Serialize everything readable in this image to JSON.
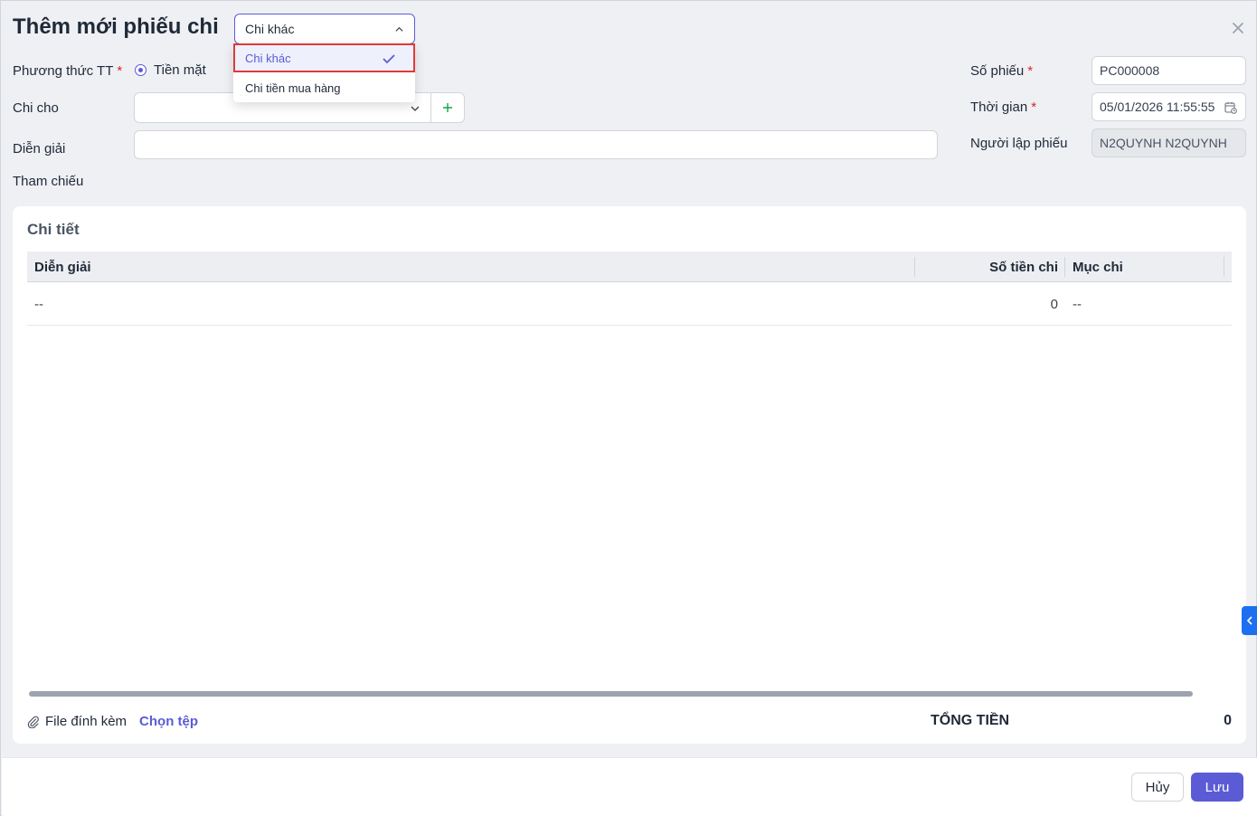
{
  "modal": {
    "title": "Thêm mới phiếu chi",
    "type_select_value": "Chi khác",
    "type_options": [
      "Chi khác",
      "Chi tiền mua hàng"
    ]
  },
  "form": {
    "payment_method_label": "Phương thức TT",
    "payment_method_value": "Tiền mặt",
    "pay_to_label": "Chi cho",
    "pay_to_value": "",
    "description_label": "Diễn giải",
    "description_value": "",
    "reference_label": "Tham chiếu",
    "voucher_no_label": "Số phiếu",
    "voucher_no_value": "PC000008",
    "time_label": "Thời gian",
    "time_value": "05/01/2026 11:55:55",
    "creator_label": "Người lập phiếu",
    "creator_value": "N2QUYNH N2QUYNH",
    "required_mark": "*"
  },
  "details": {
    "title": "Chi tiết",
    "columns": [
      "Diễn giải",
      "Số tiền chi",
      "Mục chi"
    ],
    "rows": [
      [
        "--",
        "0",
        "--"
      ]
    ]
  },
  "attachments": {
    "label": "File đính kèm",
    "choose_label": "Chọn tệp"
  },
  "total": {
    "label": "TỔNG TIỀN",
    "value": "0"
  },
  "footer": {
    "cancel_label": "Hủy",
    "save_label": "Lưu"
  },
  "colors": {
    "accent": "#5b5bd6",
    "highlight_border": "#e03a3a",
    "side_tab": "#1d6ff2"
  }
}
